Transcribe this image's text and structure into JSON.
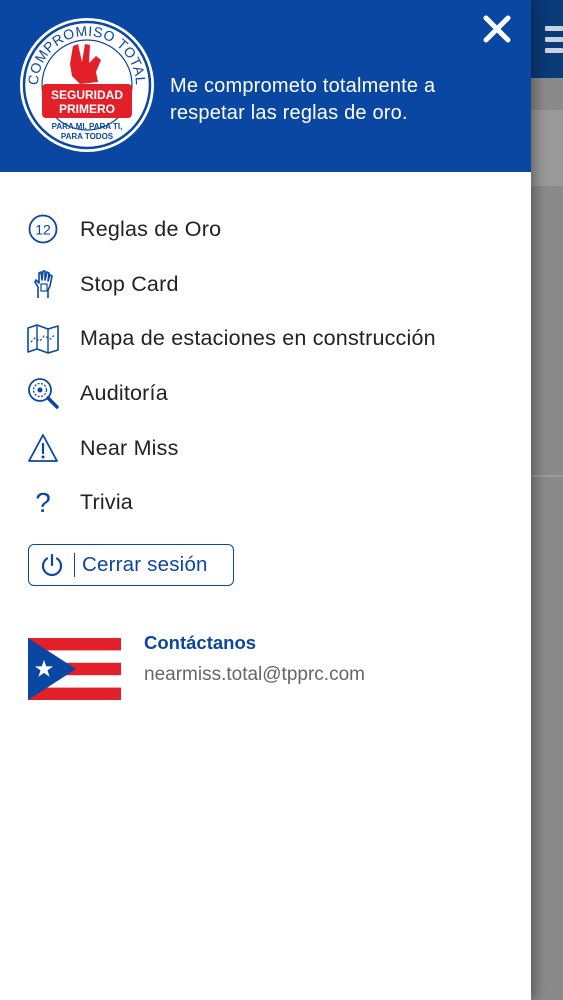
{
  "header": {
    "badge_top_text": "COMPROMISO TOTAL",
    "badge_main_line1": "SEGURIDAD",
    "badge_main_line2": "PRIMERO",
    "badge_bottom_line1": "PARA MI, PARA TI,",
    "badge_bottom_line2": "PARA TODOS",
    "tagline_line1": "Me comprometo totalmente a",
    "tagline_line2": "respetar las reglas de oro.",
    "close_icon": "close-icon"
  },
  "menu": {
    "items": [
      {
        "label": "Reglas de Oro",
        "icon": "twelve-circle-icon",
        "icon_text": "12"
      },
      {
        "label": "Stop Card",
        "icon": "stop-hand-icon"
      },
      {
        "label": "Mapa de estaciones en construcción",
        "icon": "map-icon"
      },
      {
        "label": "Auditoría",
        "icon": "audit-magnifier-icon"
      },
      {
        "label": "Near Miss",
        "icon": "warning-triangle-icon"
      },
      {
        "label": "Trivia",
        "icon": "question-icon",
        "icon_text": "?"
      }
    ]
  },
  "logout": {
    "label": "Cerrar sesión",
    "icon": "power-icon"
  },
  "contact": {
    "title": "Contáctanos",
    "email": "nearmiss.total@tpprc.com",
    "flag": "puerto-rico-flag"
  },
  "colors": {
    "primary": "#0a47a3",
    "brand_red": "#e3202a",
    "text": "#222222",
    "muted": "#666666"
  }
}
